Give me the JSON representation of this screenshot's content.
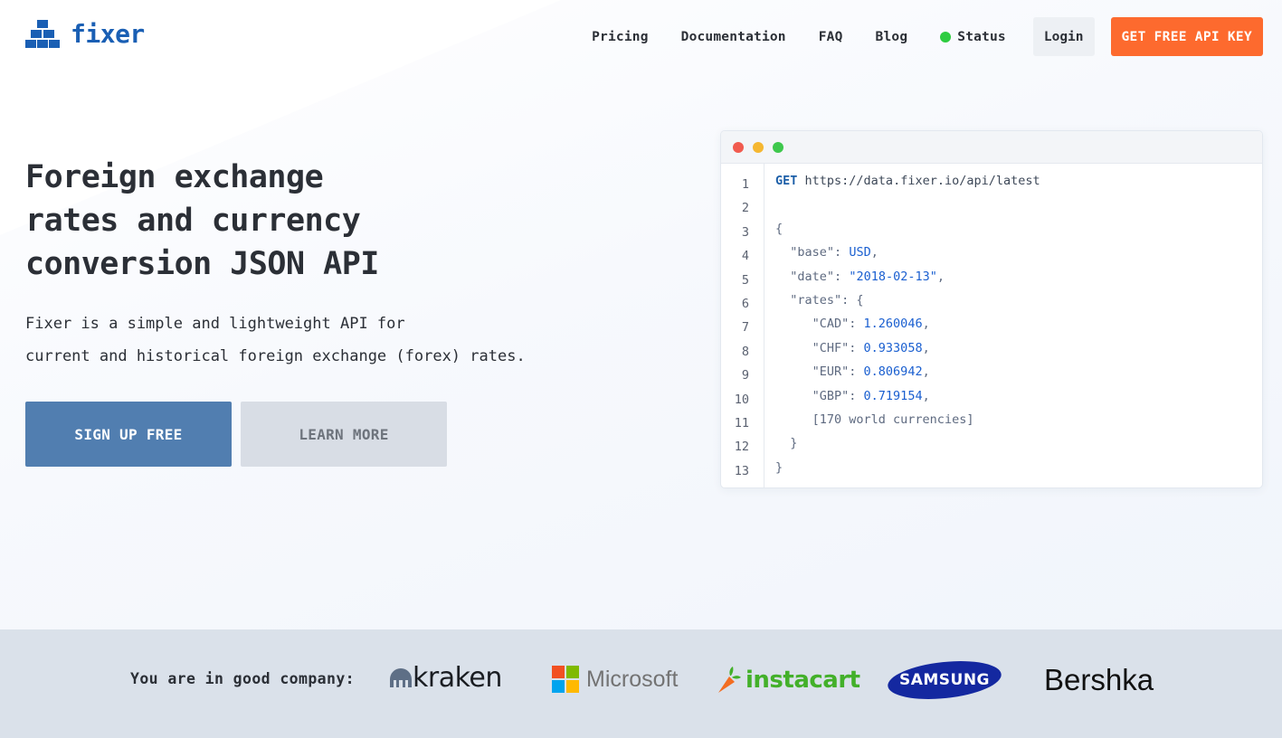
{
  "brand": {
    "name": "fixer",
    "color": "#1a5fb4"
  },
  "nav": {
    "links": [
      "Pricing",
      "Documentation",
      "FAQ",
      "Blog"
    ],
    "status_label": "Status",
    "status_color": "#2ecc40",
    "login_label": "Login",
    "cta_label": "GET FREE API KEY",
    "cta_color": "#fd6a2e"
  },
  "hero": {
    "title_lines": [
      "Foreign exchange",
      "rates and currency",
      "conversion JSON API"
    ],
    "subtitle_lines": [
      "Fixer is a simple and lightweight API for",
      "current and historical foreign exchange (forex) rates."
    ],
    "primary_button": "SIGN UP FREE",
    "secondary_button": "LEARN MORE"
  },
  "code_window": {
    "line_numbers": [
      "1",
      "2",
      "3",
      "4",
      "5",
      "6",
      "7",
      "8",
      "9",
      "10",
      "11",
      "12",
      "13"
    ],
    "request_method": "GET",
    "request_url": "https://data.fixer.io/api/latest",
    "base_key": "\"base\"",
    "base_value": "USD",
    "date_key": "\"date\"",
    "date_value": "\"2018-02-13\"",
    "rates_key": "\"rates\"",
    "rates": [
      {
        "code": "\"CAD\"",
        "value": "1.260046"
      },
      {
        "code": "\"CHF\"",
        "value": "0.933058"
      },
      {
        "code": "\"EUR\"",
        "value": "0.806942"
      },
      {
        "code": "\"GBP\"",
        "value": "0.719154"
      }
    ],
    "more_note": "[170 world currencies]"
  },
  "partners": {
    "label": "You are in good company:",
    "logos": [
      "kraken",
      "Microsoft",
      "instacart",
      "SAMSUNG",
      "Bershka"
    ]
  }
}
